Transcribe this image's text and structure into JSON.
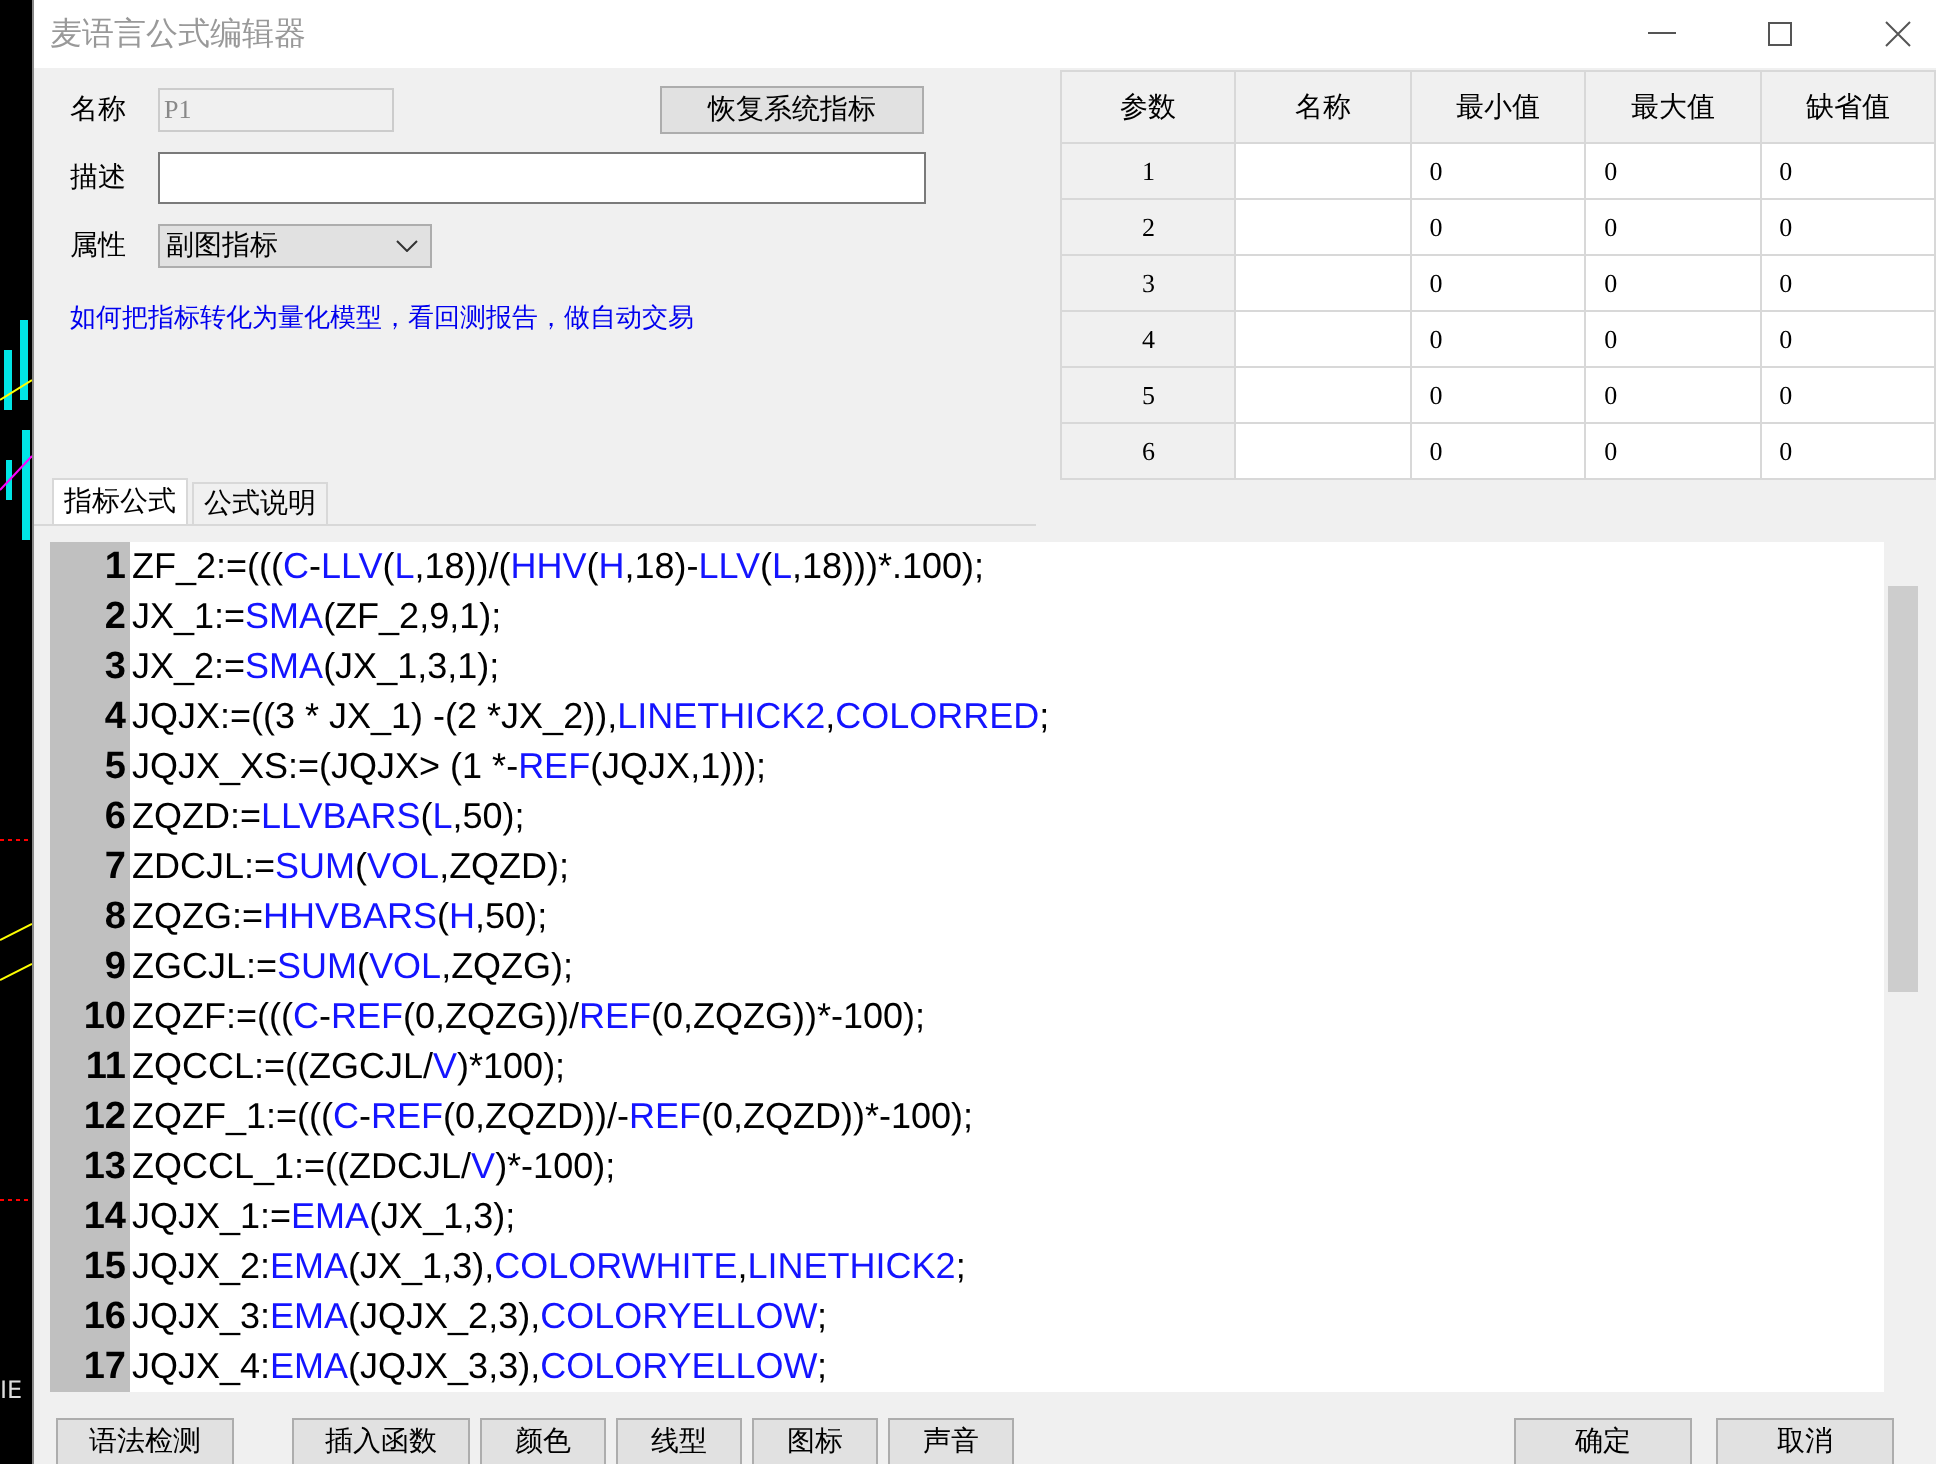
{
  "background_app": {
    "text": "IE"
  },
  "window": {
    "title": "麦语言公式编辑器"
  },
  "form": {
    "name_label": "名称",
    "name_value": "P1",
    "name_disabled": true,
    "restore_button": "恢复系统指标",
    "description_label": "描述",
    "attribute_label": "属性",
    "attribute_value": "副图指标",
    "help_link": "如何把指标转化为量化模型，看回测报告，做自动交易"
  },
  "params_table": {
    "columns": [
      "参数",
      "名称",
      "最小值",
      "最大值",
      "缺省值"
    ],
    "rows": [
      {
        "param": "1",
        "min": "0",
        "max": "0",
        "default": "0"
      },
      {
        "param": "2",
        "min": "0",
        "max": "0",
        "default": "0"
      },
      {
        "param": "3",
        "min": "0",
        "max": "0",
        "default": "0"
      },
      {
        "param": "4",
        "min": "0",
        "max": "0",
        "default": "0"
      },
      {
        "param": "5",
        "min": "0",
        "max": "0",
        "default": "0"
      },
      {
        "param": "6",
        "min": "0",
        "max": "0",
        "default": "0"
      }
    ]
  },
  "tabs": [
    {
      "label": "指标公式",
      "selected": true
    },
    {
      "label": "公式说明",
      "selected": false
    }
  ],
  "editor": {
    "lines": [
      {
        "number": "1",
        "segments": [
          {
            "text": "ZF_2:=(((",
            "kind": "plain"
          },
          {
            "text": "C",
            "kind": "keyword"
          },
          {
            "text": "-",
            "kind": "plain"
          },
          {
            "text": "LLV",
            "kind": "keyword"
          },
          {
            "text": "(",
            "kind": "plain"
          },
          {
            "text": "L",
            "kind": "keyword"
          },
          {
            "text": ",18))/(",
            "kind": "plain"
          },
          {
            "text": "HHV",
            "kind": "keyword"
          },
          {
            "text": "(",
            "kind": "plain"
          },
          {
            "text": "H",
            "kind": "keyword"
          },
          {
            "text": ",18)-",
            "kind": "plain"
          },
          {
            "text": "LLV",
            "kind": "keyword"
          },
          {
            "text": "(",
            "kind": "plain"
          },
          {
            "text": "L",
            "kind": "keyword"
          },
          {
            "text": ",18)))*.100);",
            "kind": "plain"
          }
        ]
      },
      {
        "number": "2",
        "segments": [
          {
            "text": "JX_1:=",
            "kind": "plain"
          },
          {
            "text": "SMA",
            "kind": "keyword"
          },
          {
            "text": "(ZF_2,9,1);",
            "kind": "plain"
          }
        ]
      },
      {
        "number": "3",
        "segments": [
          {
            "text": "JX_2:=",
            "kind": "plain"
          },
          {
            "text": "SMA",
            "kind": "keyword"
          },
          {
            "text": "(JX_1,3,1);",
            "kind": "plain"
          }
        ]
      },
      {
        "number": "4",
        "segments": [
          {
            "text": "JQJX:=((3 * JX_1) -(2 *JX_2)),",
            "kind": "plain"
          },
          {
            "text": "LINETHICK2",
            "kind": "keyword"
          },
          {
            "text": ",",
            "kind": "plain"
          },
          {
            "text": "COLORRED",
            "kind": "keyword"
          },
          {
            "text": ";",
            "kind": "plain"
          }
        ]
      },
      {
        "number": "5",
        "segments": [
          {
            "text": "JQJX_XS:=(JQJX> (1 *-",
            "kind": "plain"
          },
          {
            "text": "REF",
            "kind": "keyword"
          },
          {
            "text": "(JQJX,1)));",
            "kind": "plain"
          }
        ]
      },
      {
        "number": "6",
        "segments": [
          {
            "text": "ZQZD:=",
            "kind": "plain"
          },
          {
            "text": "LLVBARS",
            "kind": "keyword"
          },
          {
            "text": "(",
            "kind": "plain"
          },
          {
            "text": "L",
            "kind": "keyword"
          },
          {
            "text": ",50);",
            "kind": "plain"
          }
        ]
      },
      {
        "number": "7",
        "segments": [
          {
            "text": "ZDCJL:=",
            "kind": "plain"
          },
          {
            "text": "SUM",
            "kind": "keyword"
          },
          {
            "text": "(",
            "kind": "plain"
          },
          {
            "text": "VOL",
            "kind": "keyword"
          },
          {
            "text": ",ZQZD);",
            "kind": "plain"
          }
        ]
      },
      {
        "number": "8",
        "segments": [
          {
            "text": "ZQZG:=",
            "kind": "plain"
          },
          {
            "text": "HHVBARS",
            "kind": "keyword"
          },
          {
            "text": "(",
            "kind": "plain"
          },
          {
            "text": "H",
            "kind": "keyword"
          },
          {
            "text": ",50);",
            "kind": "plain"
          }
        ]
      },
      {
        "number": "9",
        "segments": [
          {
            "text": "ZGCJL:=",
            "kind": "plain"
          },
          {
            "text": "SUM",
            "kind": "keyword"
          },
          {
            "text": "(",
            "kind": "plain"
          },
          {
            "text": "VOL",
            "kind": "keyword"
          },
          {
            "text": ",ZQZG);",
            "kind": "plain"
          }
        ]
      },
      {
        "number": "10",
        "segments": [
          {
            "text": "ZQZF:=(((",
            "kind": "plain"
          },
          {
            "text": "C",
            "kind": "keyword"
          },
          {
            "text": "-",
            "kind": "plain"
          },
          {
            "text": "REF",
            "kind": "keyword"
          },
          {
            "text": "(0,ZQZG))/",
            "kind": "plain"
          },
          {
            "text": "REF",
            "kind": "keyword"
          },
          {
            "text": "(0,ZQZG))*-100);",
            "kind": "plain"
          }
        ]
      },
      {
        "number": "11",
        "segments": [
          {
            "text": "ZQCCL:=((ZGCJL/",
            "kind": "plain"
          },
          {
            "text": "V",
            "kind": "keyword"
          },
          {
            "text": ")*100);",
            "kind": "plain"
          }
        ]
      },
      {
        "number": "12",
        "segments": [
          {
            "text": "ZQZF_1:=(((",
            "kind": "plain"
          },
          {
            "text": "C",
            "kind": "keyword"
          },
          {
            "text": "-",
            "kind": "plain"
          },
          {
            "text": "REF",
            "kind": "keyword"
          },
          {
            "text": "(0,ZQZD))/-",
            "kind": "plain"
          },
          {
            "text": "REF",
            "kind": "keyword"
          },
          {
            "text": "(0,ZQZD))*-100);",
            "kind": "plain"
          }
        ]
      },
      {
        "number": "13",
        "segments": [
          {
            "text": "ZQCCL_1:=((ZDCJL/",
            "kind": "plain"
          },
          {
            "text": "V",
            "kind": "keyword"
          },
          {
            "text": ")*-100);",
            "kind": "plain"
          }
        ]
      },
      {
        "number": "14",
        "segments": [
          {
            "text": "JQJX_1:=",
            "kind": "plain"
          },
          {
            "text": "EMA",
            "kind": "keyword"
          },
          {
            "text": "(JX_1,3);",
            "kind": "plain"
          }
        ]
      },
      {
        "number": "15",
        "segments": [
          {
            "text": "JQJX_2:",
            "kind": "plain"
          },
          {
            "text": "EMA",
            "kind": "keyword"
          },
          {
            "text": "(JX_1,3),",
            "kind": "plain"
          },
          {
            "text": "COLORWHITE",
            "kind": "keyword"
          },
          {
            "text": ",",
            "kind": "plain"
          },
          {
            "text": "LINETHICK2",
            "kind": "keyword"
          },
          {
            "text": ";",
            "kind": "plain"
          }
        ]
      },
      {
        "number": "16",
        "segments": [
          {
            "text": "JQJX_3:",
            "kind": "plain"
          },
          {
            "text": "EMA",
            "kind": "keyword"
          },
          {
            "text": "(JQJX_2,3),",
            "kind": "plain"
          },
          {
            "text": "COLORYELLOW",
            "kind": "keyword"
          },
          {
            "text": ";",
            "kind": "plain"
          }
        ]
      },
      {
        "number": "17",
        "segments": [
          {
            "text": "JQJX_4:",
            "kind": "plain"
          },
          {
            "text": "EMA",
            "kind": "keyword"
          },
          {
            "text": "(JQJX_3,3),",
            "kind": "plain"
          },
          {
            "text": "COLORYELLOW",
            "kind": "keyword"
          },
          {
            "text": ";",
            "kind": "plain"
          }
        ]
      }
    ]
  },
  "left_buttons": [
    "语法检测",
    "插入函数",
    "颜色",
    "线型",
    "图标",
    "声音"
  ],
  "right_buttons": [
    "确定",
    "取消"
  ]
}
